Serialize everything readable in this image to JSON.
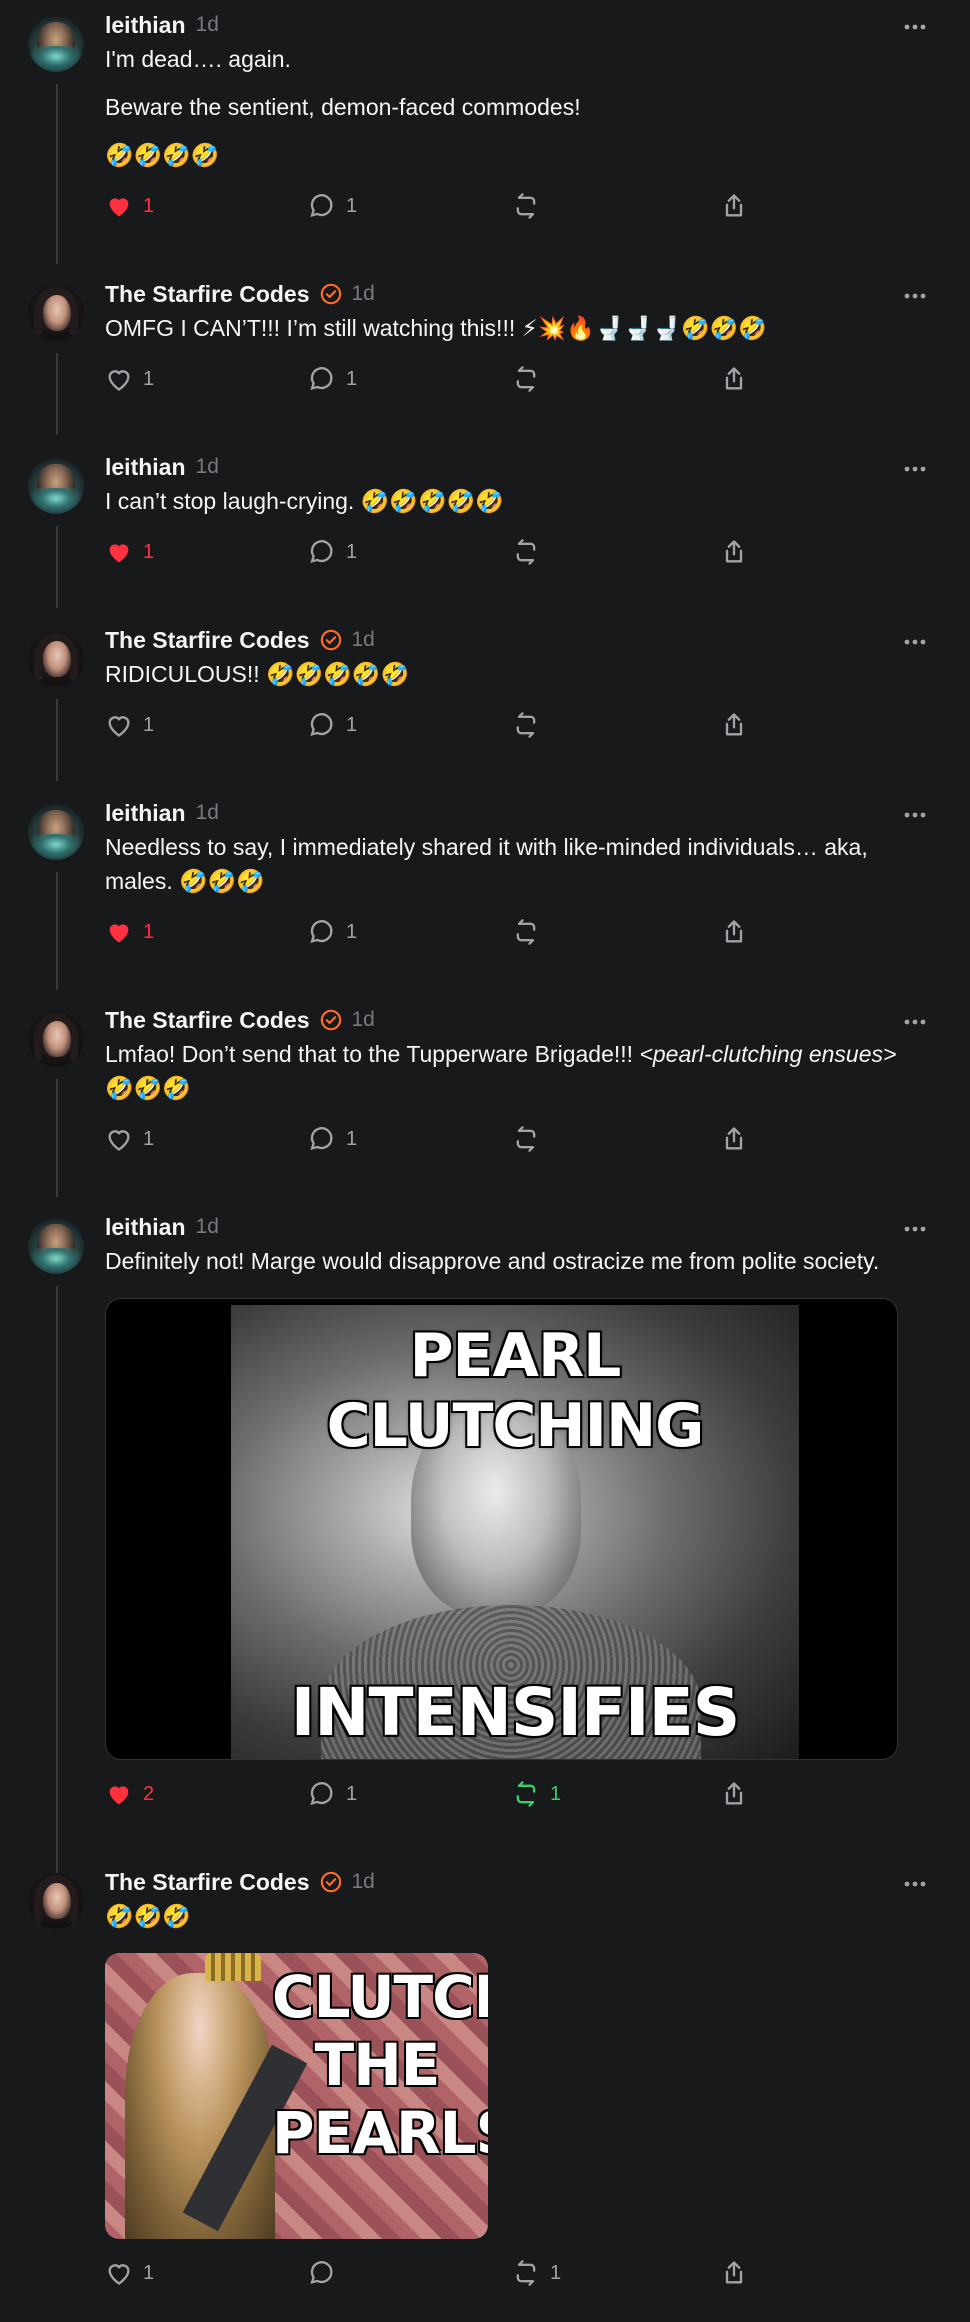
{
  "colors": {
    "background": "#18191b",
    "like_active": "#ff3040",
    "repost_active": "#37d06b",
    "verified": "#ff6a2a",
    "muted": "#777a80"
  },
  "icons": {
    "like": "heart-icon",
    "comment": "comment-icon",
    "repost": "repost-icon",
    "share": "share-icon",
    "more": "more-icon",
    "verified": "verified-badge-icon"
  },
  "posts": [
    {
      "author": "leithian",
      "time": "1d",
      "paragraphs": [
        "I'm dead…. again.",
        "Beware the sentient, demon-faced commodes!",
        "🤣🤣🤣🤣"
      ],
      "likes": "1",
      "liked": true,
      "comments": "1",
      "reposts": "",
      "reposted": false
    },
    {
      "author": "The Starfire Codes",
      "verified": true,
      "time": "1d",
      "paragraphs": [
        "OMFG I CAN’T!!! I’m still watching this!!! ⚡💥🔥🚽🚽🚽🤣🤣🤣"
      ],
      "likes": "1",
      "liked": false,
      "comments": "1",
      "reposts": "",
      "reposted": false
    },
    {
      "author": "leithian",
      "time": "1d",
      "paragraphs": [
        "I can’t stop laugh-crying. 🤣🤣🤣🤣🤣"
      ],
      "likes": "1",
      "liked": true,
      "comments": "1",
      "reposts": "",
      "reposted": false
    },
    {
      "author": "The Starfire Codes",
      "verified": true,
      "time": "1d",
      "paragraphs": [
        "RIDICULOUS!! 🤣🤣🤣🤣🤣"
      ],
      "likes": "1",
      "liked": false,
      "comments": "1",
      "reposts": "",
      "reposted": false
    },
    {
      "author": "leithian",
      "time": "1d",
      "paragraphs": [
        "Needless to say, I immediately shared it with like-minded individuals… aka, males. 🤣🤣🤣"
      ],
      "likes": "1",
      "liked": true,
      "comments": "1",
      "reposts": "",
      "reposted": false
    },
    {
      "author": "The Starfire Codes",
      "verified": true,
      "time": "1d",
      "paragraphs": [
        "Lmfao! Don’t send that to the Tupperware Brigade!!! "
      ],
      "italic": "<pearl-clutching ensues>",
      "paragraphs_after": "🤣🤣🤣",
      "likes": "1",
      "liked": false,
      "comments": "1",
      "reposts": "",
      "reposted": false
    },
    {
      "author": "leithian",
      "time": "1d",
      "paragraphs": [
        "Definitely not! Marge would disapprove and ostracize me from polite society."
      ],
      "image_top": "PEARL CLUTCHING",
      "image_bottom": "INTENSIFIES",
      "likes": "2",
      "liked": true,
      "comments": "1",
      "reposts": "1",
      "reposted": true
    },
    {
      "author": "The Starfire Codes",
      "verified": true,
      "time": "1d",
      "paragraphs": [
        "🤣🤣🤣"
      ],
      "image_text": [
        "CLUTCH",
        "THE",
        "PEARLS!"
      ],
      "likes": "1",
      "liked": false,
      "comments": "",
      "reposts": "1",
      "reposted": false
    }
  ]
}
